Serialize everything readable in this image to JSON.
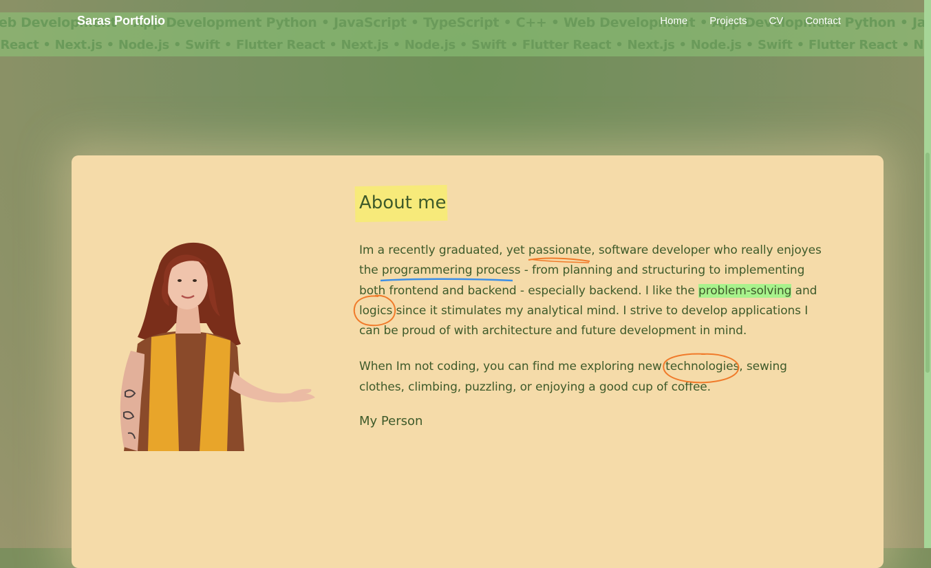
{
  "site": {
    "brand": "Saras Portfolio"
  },
  "nav": {
    "items": [
      {
        "label": "Home"
      },
      {
        "label": "Projects"
      },
      {
        "label": "CV"
      },
      {
        "label": "Contact"
      }
    ]
  },
  "marquee": {
    "row1": "Web Development • App Development Python • JavaScript • TypeScript • C++ • Web Development • App Development Python • JavaScript • TypeScript • C++",
    "row2": "er React • Next.js • Node.js • Swift • Flutter React • Next.js • Node.js • Swift • Flutter React • Next.js • Node.js • Swift • Flutter React • Next.js • Node.js"
  },
  "about": {
    "heading": "About me",
    "p1": {
      "t1": "Im a recently graduated, yet ",
      "passionate": "passionate",
      "t2": ", software developer who really enjoyes the ",
      "process": "programmering process",
      "t3": " - from planning and structuring to implementing both frontend and backend - especially backend. I like the ",
      "problem": "problem-solving",
      "t4": " and ",
      "logics": "logics",
      "t5": " since it stimulates my analytical mind. I strive to develop applications I can be proud of with architecture and future development in mind."
    },
    "p2": {
      "t1": "When Im not coding, you can find me exploring new ",
      "technologies": "technologies,",
      "t2": " sewing clothes, climbing, puzzling, or enjoying a good cup of coffee."
    },
    "signature": "My Person"
  },
  "colors": {
    "accent_text": "#3e5a2a",
    "card_bg": "#f5dba9",
    "highlight_yellow": "#f7ea7a",
    "highlight_green": "#a8f28c",
    "annotation_orange": "#f07a2a",
    "annotation_blue": "#3c8ee6"
  }
}
